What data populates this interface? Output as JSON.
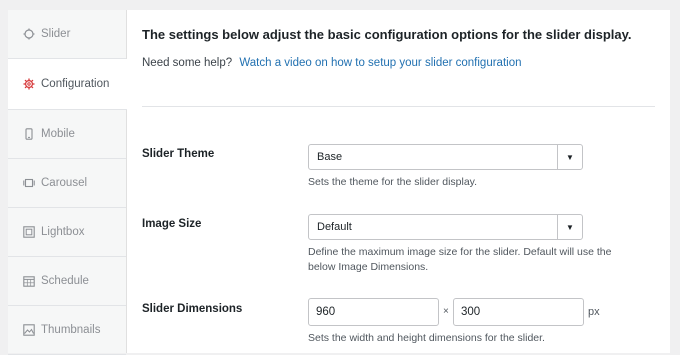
{
  "sidebar": {
    "items": [
      {
        "label": "Slider",
        "icon": "slider-icon"
      },
      {
        "label": "Configuration",
        "icon": "gear-icon"
      },
      {
        "label": "Mobile",
        "icon": "mobile-icon"
      },
      {
        "label": "Carousel",
        "icon": "carousel-icon"
      },
      {
        "label": "Lightbox",
        "icon": "lightbox-icon"
      },
      {
        "label": "Schedule",
        "icon": "calendar-icon"
      },
      {
        "label": "Thumbnails",
        "icon": "image-icon"
      }
    ],
    "active_index": 1,
    "active_icon_color": "#d63638"
  },
  "main": {
    "heading": "The settings below adjust the basic configuration options for the slider display.",
    "help_prefix": "Need some help?",
    "help_link": "Watch a video on how to setup your slider configuration",
    "theme": {
      "label": "Slider Theme",
      "value": "Base",
      "description": "Sets the theme for the slider display."
    },
    "image_size": {
      "label": "Image Size",
      "value": "Default",
      "description": "Define the maximum image size for the slider. Default will use the below Image Dimensions."
    },
    "dimensions": {
      "label": "Slider Dimensions",
      "width": "960",
      "separator": "×",
      "height": "300",
      "unit": "px",
      "description": "Sets the width and height dimensions for the slider."
    }
  },
  "colors": {
    "link": "#2271b1",
    "background": "#f0f0f1"
  }
}
